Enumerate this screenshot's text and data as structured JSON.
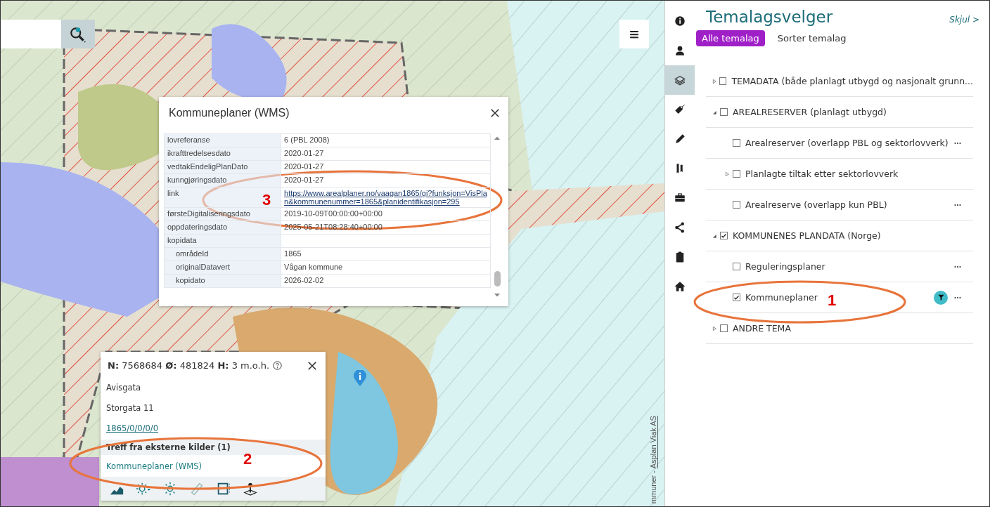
{
  "map": {
    "attribution_prefix": "mmuner - ",
    "attribution_link": "Asplan Viak AS"
  },
  "feature_popup": {
    "title": "Kommuneplaner (WMS)",
    "rows": [
      {
        "key": "lovreferanse",
        "value": "6 (PBL 2008)",
        "kind": "text"
      },
      {
        "key": "ikrafttredelsesdato",
        "value": "2020-01-27",
        "kind": "text"
      },
      {
        "key": "vedtakEndeligPlanDato",
        "value": "2020-01-27",
        "kind": "text"
      },
      {
        "key": "kunngjøringsdato",
        "value": "2020-01-27",
        "kind": "text"
      },
      {
        "key": "link",
        "value": "https://www.arealplaner.no/vaagan1865/gi?funksjon=VisPlan&kommunenummer=1865&planidentifikasjon=295",
        "kind": "link"
      },
      {
        "key": "førsteDigitaliseringsdato",
        "value": "2019-10-09T00:00:00+00:00",
        "kind": "text"
      },
      {
        "key": "oppdateringsdato",
        "value": "2025-05-21T08:28:40+00:00",
        "kind": "text"
      },
      {
        "key": "kopidata",
        "kind": "group",
        "children": [
          {
            "key": "områdeId",
            "value": "1865",
            "kind": "text"
          },
          {
            "key": "originalDatavert",
            "value": "Vågan kommune",
            "kind": "text"
          },
          {
            "key": "kopidato",
            "value": "2026-02-02",
            "kind": "text"
          }
        ]
      }
    ]
  },
  "position_popup": {
    "coordinates": "**N:** 7568684 **Ø:** 481824 **H:** 3 m.o.h.",
    "lines": [
      {
        "text": "Avisgata",
        "kind": "text"
      },
      {
        "text": "Storgata 11",
        "kind": "text"
      },
      {
        "text": "1865/0/0/0/0",
        "kind": "link"
      }
    ],
    "external_heading": "Treff fra eksterne kilder (1)",
    "external_results": [
      "Kommuneplaner (WMS)"
    ]
  },
  "panel": {
    "title": "Temalagsvelger",
    "hide_link": "Skjul >",
    "sidebar": [
      {
        "selected": false
      },
      {
        "selected": false
      },
      {
        "selected": true
      },
      {
        "selected": false
      },
      {
        "selected": false
      },
      {
        "selected": false
      },
      {
        "selected": false
      },
      {
        "selected": false
      },
      {
        "selected": false
      },
      {
        "selected": false
      }
    ],
    "tabs": [
      {
        "label": "Alle temalag",
        "selected": true
      },
      {
        "label": "Sorter temalag",
        "selected": false
      }
    ],
    "layers": [
      {
        "label": "TEMADATA (både planlagt utbygd og nasjonalt grunn...",
        "kind": "group",
        "checked": false,
        "expanded": false
      },
      {
        "label": "AREALRESERVER (planlagt utbygd)",
        "kind": "group",
        "checked": false,
        "expanded": true,
        "children": [
          {
            "label": "Arealreserver (overlapp PBL og sektorlovverk)",
            "kind": "layer",
            "checked": false,
            "filtered": false
          },
          {
            "label": "Planlagte tiltak etter sektorlovverk",
            "kind": "group",
            "checked": false,
            "expanded": false
          },
          {
            "label": "Arealreserve (overlapp kun PBL)",
            "kind": "layer",
            "checked": false,
            "filtered": false
          }
        ]
      },
      {
        "label": "KOMMUNENES PLANDATA (Norge)",
        "kind": "group",
        "checked": true,
        "expanded": true,
        "children": [
          {
            "label": "Reguleringsplaner",
            "kind": "layer",
            "checked": false,
            "filtered": false
          },
          {
            "label": "Kommuneplaner",
            "kind": "layer",
            "checked": true,
            "filtered": true
          }
        ]
      },
      {
        "label": "ANDRE TEMA",
        "kind": "group",
        "checked": false,
        "expanded": false
      }
    ]
  },
  "annotations": [
    {
      "label": "1"
    },
    {
      "label": "2"
    },
    {
      "label": "3"
    }
  ]
}
